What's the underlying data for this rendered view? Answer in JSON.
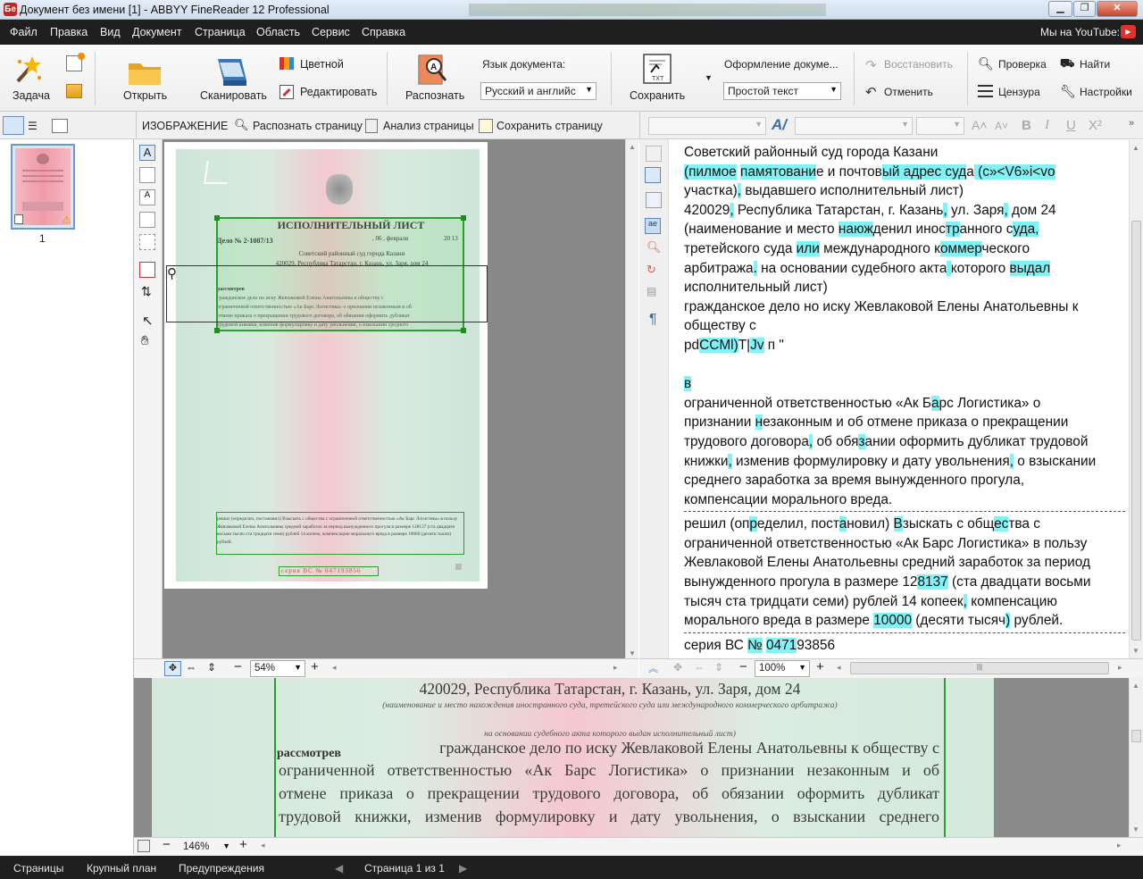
{
  "window": {
    "title": "Документ без имени [1] - ABBYY FineReader 12 Professional",
    "app_icon": "abbyy-logo-icon",
    "controls": [
      "minimize",
      "maximize",
      "close"
    ]
  },
  "menu": {
    "items": [
      "Файл",
      "Правка",
      "Вид",
      "Документ",
      "Страница",
      "Область",
      "Сервис",
      "Справка"
    ],
    "youtube": "Мы на YouTube:"
  },
  "toolbar": {
    "task": "Задача",
    "open": "Открыть",
    "scan": "Сканировать",
    "color": "Цветной",
    "edit": "Редактировать",
    "recognize": "Распознать",
    "doc_lang_label": "Язык документа:",
    "doc_lang_value": "Русский и английс",
    "save": "Сохранить",
    "format_label": "Оформление докуме...",
    "format_value": "Простой текст",
    "restore": "Восстановить",
    "undo": "Отменить",
    "check": "Проверка",
    "censor": "Цензура",
    "find": "Найти",
    "settings": "Настройки"
  },
  "imagebar": {
    "title": "ИЗОБРАЖЕНИЕ",
    "recognize_page": "Распознать страницу",
    "analyze_page": "Анализ страницы",
    "save_page": "Сохранить страницу"
  },
  "thumbnails": [
    {
      "number": "1",
      "warning": true
    }
  ],
  "image_zoom": "54%",
  "text_zoom": "100%",
  "zoom_view": "146%",
  "doc_preview": {
    "heading": "ИСПОЛНИТЕЛЬНЫЙ ЛИСТ",
    "case_line": "Дело № 2-1087/13",
    "date_line": ", 06 , февраля",
    "year": "20 13",
    "court": "Советский районный суд города Казани",
    "address": "420029, Республика Татарстан, г. Казань, ул. Заря, дом 24",
    "caption1": "(наименование и место нахождения иностранного суда, третейского суда или международного коммерческого арбитража)",
    "caption2": "на основании судебного акта которого выдан исполнительный лист)",
    "considered": "рассмотрев",
    "body": [
      "гражданское дело по иску Жевлаковой Елены Анатольевны к обществу с",
      "ограниченной ответственностью «Ак Барс Логистика» о признании незаконным и об",
      "отмене приказа о прекращении трудового договора, об обязании оформить дубликат",
      "трудовой книжки, изменив формулировку и дату увольнения, о взыскании среднего"
    ],
    "decision": "решил (определил, постановил) Взыскать с общества с ограниченной ответственностью «Ак Барс Логистика» в пользу Жевлаковой Елены Анатольевны средний заработок за период вынужденного прогула в размере 128137 (ста двадцати восьми тысяч ста тридцати семи) рублей 14 копеек, компенсацию морального вреда в размере 10000 (десяти тысяч) рублей.",
    "series": "серия ВС № 047193856"
  },
  "recognized_text": {
    "block1": [
      {
        "t": "Советский районный суд города Казани",
        "hl": []
      },
      {
        "t": "(пилмое памятование и почтовый адрес суда (с»<V6»i<vo",
        "hl": [
          [
            0,
            7
          ],
          [
            8,
            18
          ],
          [
            28,
            40
          ],
          [
            41,
            53
          ]
        ]
      },
      {
        "t": "участка), выдавшего исполнительный лист)",
        "hl": [
          [
            8,
            9
          ]
        ]
      },
      {
        "t": "420029, Республика Татарстан, г. Казань, ул. Заря, дом 24",
        "hl": [
          [
            6,
            7
          ],
          [
            39,
            40
          ],
          [
            49,
            50
          ]
        ]
      },
      {
        "t": "(наименование и место наюжденил иностранного суда,",
        "hl": [
          [
            22,
            26
          ],
          [
            36,
            38
          ],
          [
            46,
            50
          ]
        ]
      },
      {
        "t": "третейского суда или международного коммерческого",
        "hl": [
          [
            17,
            20
          ],
          [
            37,
            42
          ]
        ]
      },
      {
        "t": "арбитража. на основании судебного акта которого выдал",
        "hl": [
          [
            9,
            10
          ],
          [
            38,
            39
          ],
          [
            48,
            53
          ]
        ]
      },
      {
        "t": "исполнительный лист)",
        "hl": []
      },
      {
        "t": "гражданское дело но иску Жевлаковой Елены Анатольевны к",
        "hl": []
      },
      {
        "t": "обществу с",
        "hl": []
      },
      {
        "t": "pdCCMl)T|Jv п                  \"",
        "hl": [
          [
            2,
            7
          ],
          [
            9,
            11
          ]
        ]
      },
      {
        "t": "",
        "hl": []
      },
      {
        "t": "в",
        "hl": [
          [
            0,
            1
          ]
        ]
      },
      {
        "t": "ограниченной ответственностью «Ак Барс Логистика» о",
        "hl": [
          [
            35,
            36
          ]
        ]
      },
      {
        "t": "признании незаконным и об отмене приказа о прекращении",
        "hl": [
          [
            10,
            11
          ]
        ]
      },
      {
        "t": "трудового договора, об обязании оформить дубликат трудовой",
        "hl": [
          [
            18,
            19
          ],
          [
            26,
            27
          ]
        ]
      },
      {
        "t": "книжки, изменив формулировку и дату увольнения, о взыскании",
        "hl": [
          [
            6,
            7
          ],
          [
            46,
            47
          ]
        ]
      },
      {
        "t": "среднего заработка за время вынужденного прогула,",
        "hl": [
          [
            49,
            50
          ]
        ]
      },
      {
        "t": "компенсации морального вреда.",
        "hl": []
      }
    ],
    "block2": [
      {
        "t": "решил (определил, постановил) Взыскать с общества с",
        "hl": [
          [
            9,
            10
          ],
          [
            22,
            23
          ],
          [
            30,
            31
          ],
          [
            44,
            46
          ]
        ]
      },
      {
        "t": "ограниченной ответственностью «Ак Барс Логистика» в пользу",
        "hl": []
      },
      {
        "t": "Жевлаковой Елены Анатольевны средний заработок за период",
        "hl": []
      },
      {
        "t": "вынужденного прогула в размере 128137 (ста двадцати восьми",
        "hl": [
          [
            33,
            37
          ]
        ]
      },
      {
        "t": "тысяч ста тридцати семи) рублей 14 копеек, компенсацию",
        "hl": [
          [
            41,
            42
          ]
        ]
      },
      {
        "t": "морального вреда в размере 10000 (десяти тысяч) рублей.",
        "hl": [
          [
            27,
            32
          ],
          [
            46,
            47
          ]
        ]
      }
    ],
    "block3": [
      {
        "t": "серия ВС № 047193856",
        "hl": [
          [
            9,
            10
          ],
          [
            11,
            15
          ]
        ]
      }
    ]
  },
  "statusbar": {
    "pages": "Страницы",
    "zoom": "Крупный план",
    "warnings": "Предупреждения",
    "page_info": "Страница 1 из 1"
  }
}
